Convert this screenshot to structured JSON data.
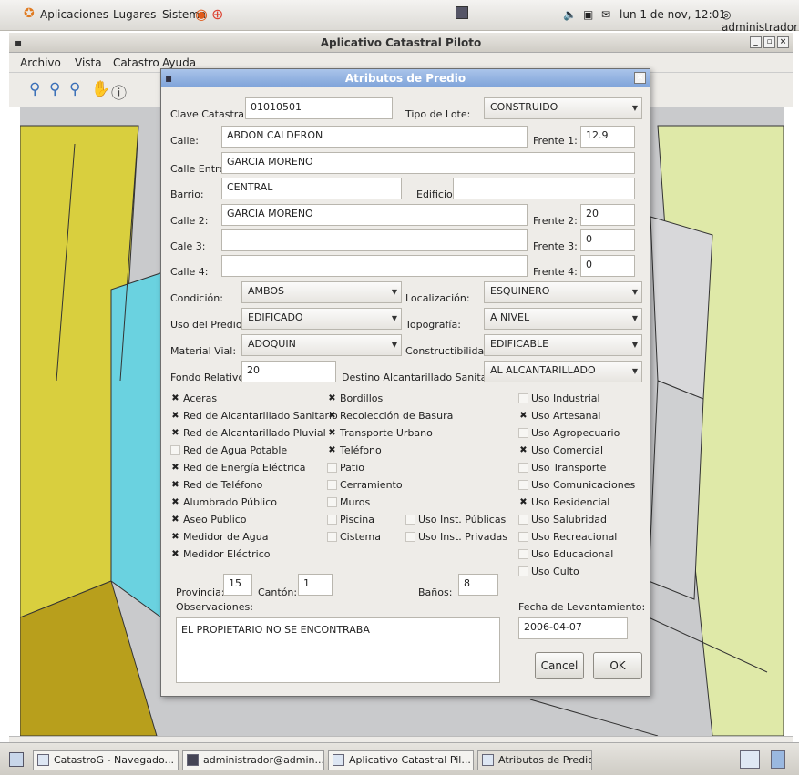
{
  "top_panel": {
    "menus": [
      "Aplicaciones",
      "Lugares",
      "Sistema"
    ],
    "clock": "lun 1 de nov, 12:01",
    "user": "administrador"
  },
  "main_window": {
    "title": "Aplicativo Catastral Piloto",
    "menus": [
      "Archivo",
      "Vista",
      "Catastro",
      "Ayuda"
    ],
    "toolbar_icons": [
      "zoom-in-icon",
      "zoom-out-icon",
      "zoom-extent-icon",
      "pan-icon",
      "info-icon"
    ]
  },
  "dialog": {
    "title": "Atributos de Predio",
    "labels": {
      "clave": "Clave Catastral:",
      "tipo_lote": "Tipo de Lote:",
      "calle": "Calle:",
      "frente1": "Frente 1:",
      "calle_entre": "Calle Entre:",
      "barrio": "Barrio:",
      "edificio": "Edificio:",
      "calle2": "Calle 2:",
      "frente2": "Frente 2:",
      "calle3": "Cale 3:",
      "frente3": "Frente 3:",
      "calle4": "Calle 4:",
      "frente4": "Frente 4:",
      "condicion": "Condición:",
      "localizacion": "Localización:",
      "uso_predio": "Uso del Predio:",
      "topografia": "Topografía:",
      "material_vial": "Material Vial:",
      "constructibilidad": "Constructibilidad:",
      "fondo_relativo": "Fondo Relativo:",
      "destino_alcantarillado": "Destino Alcantarillado Sanitario:",
      "provincia": "Provincia:",
      "canton": "Cantón:",
      "banos": "Baños:",
      "observaciones": "Observaciones:",
      "fecha": "Fecha de Levantamiento:"
    },
    "values": {
      "clave": "01010501",
      "tipo_lote": "CONSTRUIDO",
      "calle": "ABDON CALDERON",
      "frente1": "12.9",
      "calle_entre": "GARCIA MORENO",
      "barrio": "CENTRAL",
      "edificio": "",
      "calle2": "GARCIA MORENO",
      "frente2": "20",
      "calle3": "",
      "frente3": "0",
      "calle4": "",
      "frente4": "0",
      "condicion": "AMBOS",
      "localizacion": "ESQUINERO",
      "uso_predio": "EDIFICADO",
      "topografia": "A NIVEL",
      "material_vial": "ADOQUIN",
      "constructibilidad": "EDIFICABLE",
      "fondo_relativo": "20",
      "destino_alcantarillado": "AL ALCANTARILLADO",
      "provincia": "15",
      "canton": "1",
      "banos": "8",
      "observaciones": "EL PROPIETARIO NO SE ENCONTRABA",
      "fecha": "2006-04-07"
    },
    "checks_col1": [
      {
        "label": "Aceras",
        "checked": true
      },
      {
        "label": "Red de Alcantarillado Sanitario",
        "checked": true
      },
      {
        "label": "Red de Alcantarillado Pluvial",
        "checked": true
      },
      {
        "label": "Red de Agua Potable",
        "checked": false
      },
      {
        "label": "Red de Energía Eléctrica",
        "checked": true
      },
      {
        "label": "Red de Teléfono",
        "checked": true
      },
      {
        "label": "Alumbrado Público",
        "checked": true
      },
      {
        "label": "Aseo Público",
        "checked": true
      },
      {
        "label": "Medidor de Agua",
        "checked": true
      },
      {
        "label": "Medidor Eléctrico",
        "checked": true
      }
    ],
    "checks_col2": [
      {
        "label": "Bordillos",
        "checked": true
      },
      {
        "label": "Recolección de Basura",
        "checked": true
      },
      {
        "label": "Transporte Urbano",
        "checked": true
      },
      {
        "label": "Teléfono",
        "checked": true
      },
      {
        "label": "Patio",
        "checked": false
      },
      {
        "label": "Cerramiento",
        "checked": false
      },
      {
        "label": "Muros",
        "checked": false
      },
      {
        "label": "Piscina",
        "checked": false
      },
      {
        "label": "Cistema",
        "checked": false
      }
    ],
    "checks_col3": [
      {
        "label": "Uso Inst. Públicas",
        "checked": false
      },
      {
        "label": "Uso Inst. Privadas",
        "checked": false
      }
    ],
    "checks_col4": [
      {
        "label": "Uso Industrial",
        "checked": false
      },
      {
        "label": "Uso Artesanal",
        "checked": true
      },
      {
        "label": "Uso Agropecuario",
        "checked": false
      },
      {
        "label": "Uso Comercial",
        "checked": true
      },
      {
        "label": "Uso Transporte",
        "checked": false
      },
      {
        "label": "Uso Comunicaciones",
        "checked": false
      },
      {
        "label": "Uso Residencial",
        "checked": true
      },
      {
        "label": "Uso Salubridad",
        "checked": false
      },
      {
        "label": "Uso Recreacional",
        "checked": false
      },
      {
        "label": "Uso Educacional",
        "checked": false
      },
      {
        "label": "Uso Culto",
        "checked": false
      }
    ],
    "buttons": {
      "cancel": "Cancel",
      "ok": "OK"
    }
  },
  "taskbar": {
    "items": [
      "CatastroG - Navegado...",
      "administrador@admin...",
      "Aplicativo Catastral Pil...",
      "Atributos de Predio"
    ]
  }
}
